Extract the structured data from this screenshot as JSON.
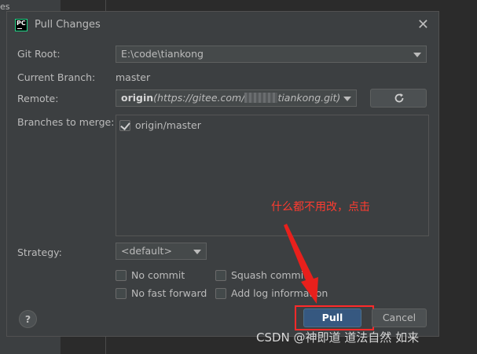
{
  "ide": {
    "left_panel_text": "es"
  },
  "dialog": {
    "title": "Pull Changes",
    "app_icon_text": "PC",
    "close_symbol": "✕"
  },
  "git_root": {
    "label": "Git Root:",
    "value": "E:\\code\\tiankong"
  },
  "current_branch": {
    "label": "Current Branch:",
    "value": "master"
  },
  "remote": {
    "label": "Remote:",
    "name": "origin",
    "url_start": "(https://gitee.com/",
    "url_end": "tiankong.git)"
  },
  "branches": {
    "label": "Branches to merge:",
    "items": [
      {
        "label": "origin/master",
        "checked": true
      }
    ]
  },
  "strategy": {
    "label": "Strategy:",
    "value": "<default>"
  },
  "options": {
    "no_commit": "No commit",
    "squash_commit": "Squash commit",
    "no_fast_forward": "No fast forward",
    "add_log_information": "Add log information"
  },
  "annotation": "什么都不用改，点击",
  "buttons": {
    "help": "?",
    "pull": "Pull",
    "cancel": "Cancel"
  },
  "watermark": "CSDN @神即道 道法自然 如来",
  "colors": {
    "annotation": "#ff3b30",
    "primary_button": "#365880",
    "highlight_box": "#ff2a2a"
  }
}
